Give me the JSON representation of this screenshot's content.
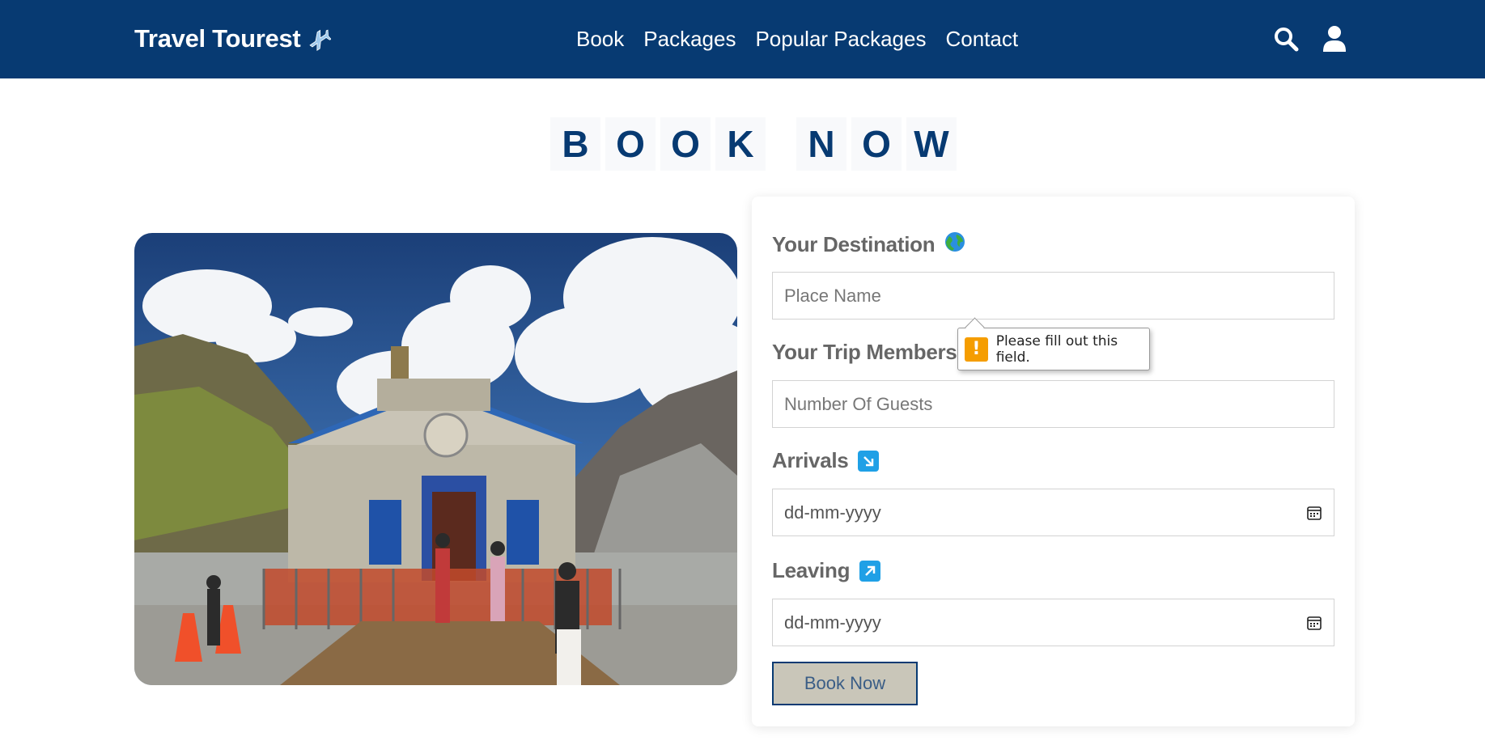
{
  "header": {
    "logo_text": "Travel Tourest",
    "logo_icon": "airplane-icon",
    "nav": [
      "Book",
      "Packages",
      "Popular Packages",
      "Contact"
    ],
    "icons": [
      "search-icon",
      "user-icon"
    ],
    "background": "#073a72"
  },
  "title": {
    "letters": [
      "B",
      "O",
      "O",
      "K",
      " ",
      "N",
      "O",
      "W"
    ],
    "color": "#073a72"
  },
  "form": {
    "destination": {
      "label": "Your Destination",
      "icon": "globe-icon",
      "placeholder": "Place Name"
    },
    "members": {
      "label": "Your Trip Members",
      "placeholder": "Number Of Guests"
    },
    "arrivals": {
      "label": "Arrivals",
      "icon": "arrow-down-right-icon",
      "value": "dd-mm-yyyy"
    },
    "leaving": {
      "label": "Leaving",
      "icon": "arrow-up-right-icon",
      "value": "dd-mm-yyyy"
    },
    "submit_label": "Book Now"
  },
  "tooltip": {
    "message": "Please fill out this field.",
    "icon": "warning-icon"
  }
}
